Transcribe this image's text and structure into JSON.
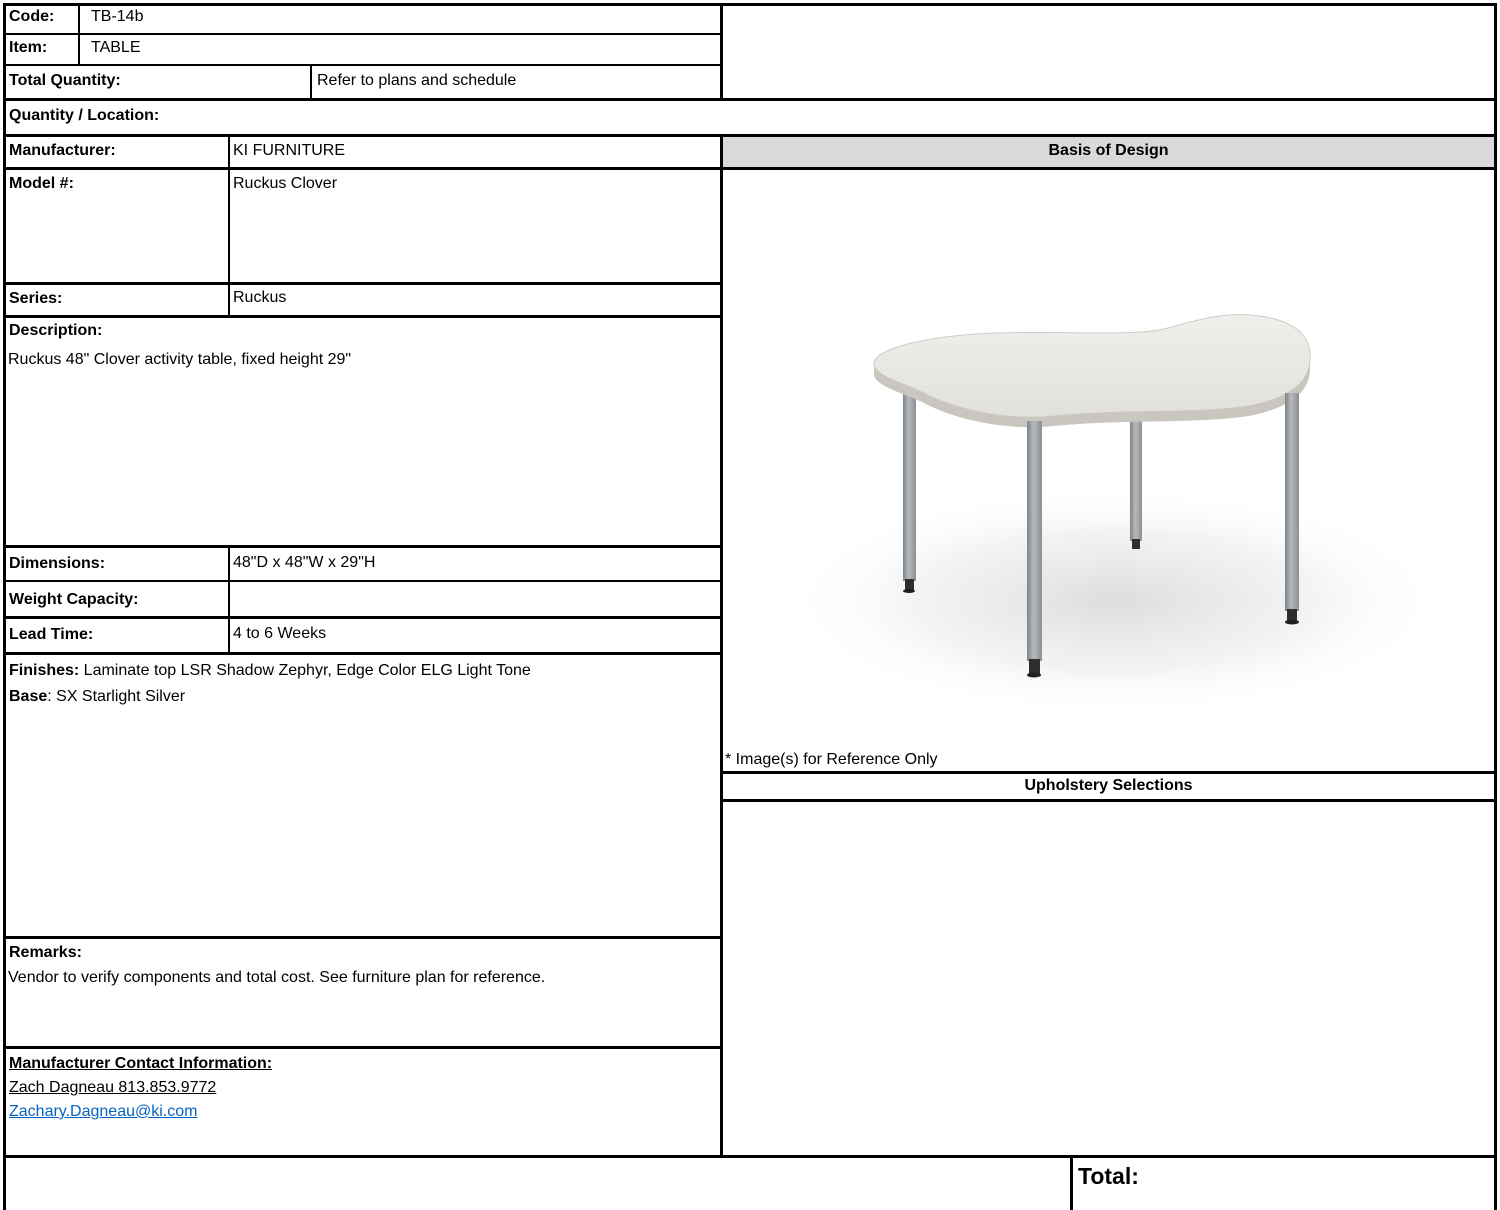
{
  "header": {
    "code_label": "Code:",
    "code_value": "TB-14b",
    "item_label": "Item:",
    "item_value": "TABLE",
    "total_quantity_label": "Total Quantity:",
    "total_quantity_value": "Refer to plans and schedule",
    "quantity_location_label": "Quantity / Location:"
  },
  "specs": {
    "manufacturer_label": "Manufacturer:",
    "manufacturer_value": "KI FURNITURE",
    "model_label": "Model #:",
    "model_value": "Ruckus Clover",
    "series_label": "Series:",
    "series_value": "Ruckus",
    "description_label": "Description:",
    "description_value": "Ruckus 48\" Clover activity table, fixed height 29\"",
    "dimensions_label": "Dimensions:",
    "dimensions_value": "48\"D x 48\"W x 29\"H",
    "weight_label": "Weight Capacity:",
    "weight_value": "",
    "lead_time_label": "Lead Time:",
    "lead_time_value": "4 to 6 Weeks"
  },
  "finishes": {
    "finishes_label": "Finishes:",
    "finishes_value": " Laminate top LSR Shadow Zephyr, Edge Color ELG Light Tone",
    "base_label": "Base",
    "base_value": ": SX Starlight Silver"
  },
  "remarks": {
    "label": "Remarks:",
    "value": "Vendor to verify components and total cost. See furniture plan for reference."
  },
  "contact": {
    "label": "Manufacturer Contact Information:",
    "name_phone": "Zach Dagneau 813.853.9772",
    "email": "Zachary.Dagneau@ki.com"
  },
  "right_panel": {
    "basis_of_design": "Basis of Design",
    "image_note": "* Image(s) for Reference Only",
    "upholstery_selections": "Upholstery Selections"
  },
  "footer": {
    "total_label": "Total:"
  },
  "colors": {
    "header_fill": "#d9d9d9",
    "link": "#0563c1",
    "table_top": "#e8e6e1",
    "table_legs": "#9ea3a6"
  }
}
